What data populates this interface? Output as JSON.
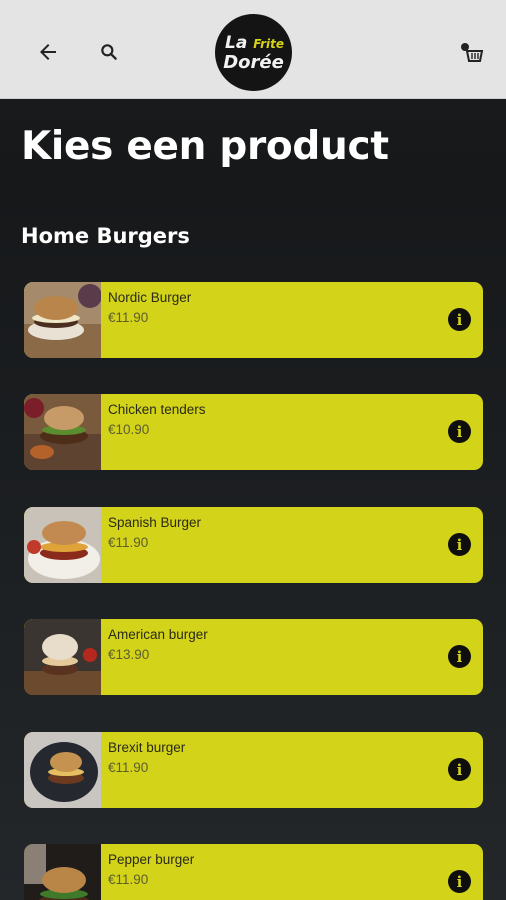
{
  "header": {
    "logo_line1_a": "La",
    "logo_line1_b": "Frite",
    "logo_line2": "Dorée"
  },
  "page_title": "Kies een product",
  "section_title": "Home Burgers",
  "colors": {
    "accent": "#d3d31a",
    "header_bg": "#e4e4e4",
    "page_bg": "#1d2023"
  },
  "products": [
    {
      "name": "Nordic Burger",
      "price": "€11.90"
    },
    {
      "name": "Chicken tenders",
      "price": "€10.90"
    },
    {
      "name": "Spanish Burger",
      "price": "€11.90"
    },
    {
      "name": "American burger",
      "price": "€13.90"
    },
    {
      "name": "Brexit burger",
      "price": "€11.90"
    },
    {
      "name": "Pepper burger",
      "price": "€11.90"
    }
  ]
}
